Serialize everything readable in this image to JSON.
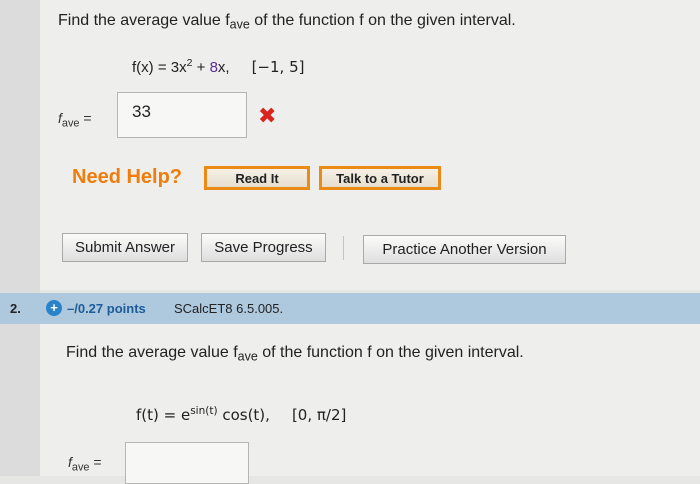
{
  "question1": {
    "prompt_part1": "Find the average value f",
    "prompt_sub": "ave",
    "prompt_part2": " of the function f on the given interval.",
    "func_lhs": "f(x) = 3x",
    "func_exp": "2",
    "func_plus": " + ",
    "func_term": "8",
    "func_var": "x,",
    "interval": "[−1, 5]",
    "answer_label_f": "f",
    "answer_label_sub": "ave",
    "answer_label_eq": " =",
    "answer_value": "33",
    "status_icon": "wrong-x-icon",
    "status_glyph": "✖"
  },
  "help": {
    "title": "Need Help?",
    "read_it": "Read It",
    "talk_to_tutor": "Talk to a Tutor"
  },
  "actions": {
    "submit": "Submit Answer",
    "save": "Save Progress",
    "practice": "Practice Another Version"
  },
  "question2": {
    "number": "2.",
    "points_icon": "plus-circle-icon",
    "points_glyph": "+",
    "points": "–/0.27 points",
    "source": "SCalcET8 6.5.005.",
    "prompt_part1": "Find the average value f",
    "prompt_sub": "ave",
    "prompt_part2": " of the function f on the given interval.",
    "func_lhs": "f(t) = e",
    "func_exp": "sin(t)",
    "func_rest": " cos(t),",
    "interval": "[0, π/2]",
    "answer_label_f": "f",
    "answer_label_sub": "ave",
    "answer_label_eq": " =",
    "answer_value": ""
  },
  "colors": {
    "accent_orange": "#ec8a16",
    "error_red": "#d8231e",
    "header_blue": "#aec8de",
    "points_blue": "#1c5d99"
  }
}
